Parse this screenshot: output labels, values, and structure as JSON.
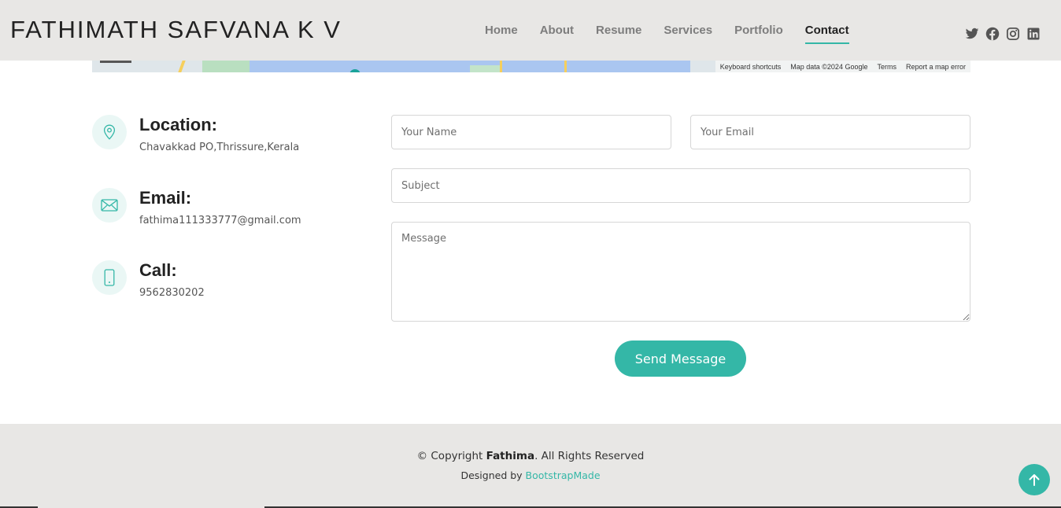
{
  "header": {
    "logo": "FATHIMATH SAFVANA K V",
    "nav": [
      {
        "label": "Home",
        "active": false
      },
      {
        "label": "About",
        "active": false
      },
      {
        "label": "Resume",
        "active": false
      },
      {
        "label": "Services",
        "active": false
      },
      {
        "label": "Portfolio",
        "active": false
      },
      {
        "label": "Contact",
        "active": true
      }
    ],
    "socials": [
      "twitter-icon",
      "facebook-icon",
      "instagram-icon",
      "linkedin-icon"
    ]
  },
  "map": {
    "attribution": [
      "Keyboard shortcuts",
      "Map data ©2024 Google",
      "Terms",
      "Report a map error"
    ]
  },
  "contact_info": {
    "location": {
      "title": "Location:",
      "text": "Chavakkad PO,Thrissure,Kerala",
      "icon": "map-pin-icon"
    },
    "email": {
      "title": "Email:",
      "text": "fathima111333777@gmail.com",
      "icon": "envelope-icon"
    },
    "call": {
      "title": "Call:",
      "text": "9562830202",
      "icon": "phone-icon"
    }
  },
  "form": {
    "name_placeholder": "Your Name",
    "email_placeholder": "Your Email",
    "subject_placeholder": "Subject",
    "message_placeholder": "Message",
    "submit_label": "Send Message"
  },
  "footer": {
    "copyright_prefix": "© Copyright ",
    "copyright_name": "Fathima",
    "copyright_suffix": ". All Rights Reserved",
    "designed_by": "Designed by ",
    "designer_link": "BootstrapMade"
  },
  "colors": {
    "accent": "#34b7a7",
    "header_bg": "#e8e7e5",
    "footer_bg": "#e8e7e5"
  }
}
